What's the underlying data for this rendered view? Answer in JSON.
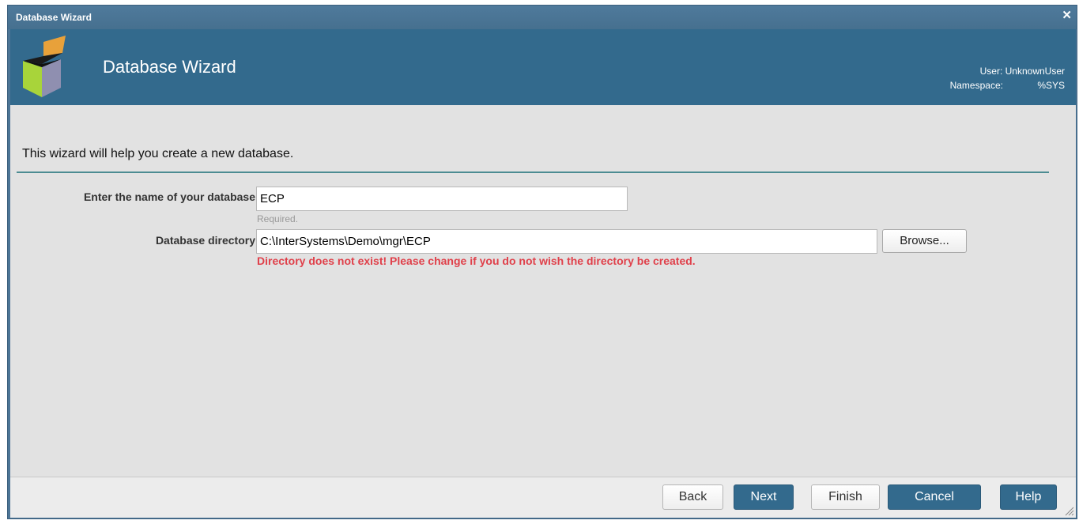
{
  "window": {
    "title": "Database Wizard",
    "close_glyph": "✕"
  },
  "header": {
    "title": "Database Wizard",
    "logo_icon": "cube-box-icon",
    "user_label": "User:",
    "user_value": "UnknownUser",
    "namespace_label": "Namespace:",
    "namespace_value": "%SYS"
  },
  "content": {
    "intro": "This wizard will help you create a new database.",
    "name_label": "Enter the name of your database",
    "name_value": "ECP",
    "name_hint": "Required.",
    "dir_label": "Database directory",
    "dir_value": "C:\\InterSystems\\Demo\\mgr\\ECP",
    "browse_label": "Browse...",
    "dir_error": "Directory does not exist! Please change if you do not wish the directory be created."
  },
  "footer": {
    "back": "Back",
    "next": "Next",
    "finish": "Finish",
    "cancel": "Cancel",
    "help": "Help"
  },
  "colors": {
    "header_bg": "#336a8d",
    "error_text": "#e0404a",
    "rule": "#4c8c92"
  }
}
